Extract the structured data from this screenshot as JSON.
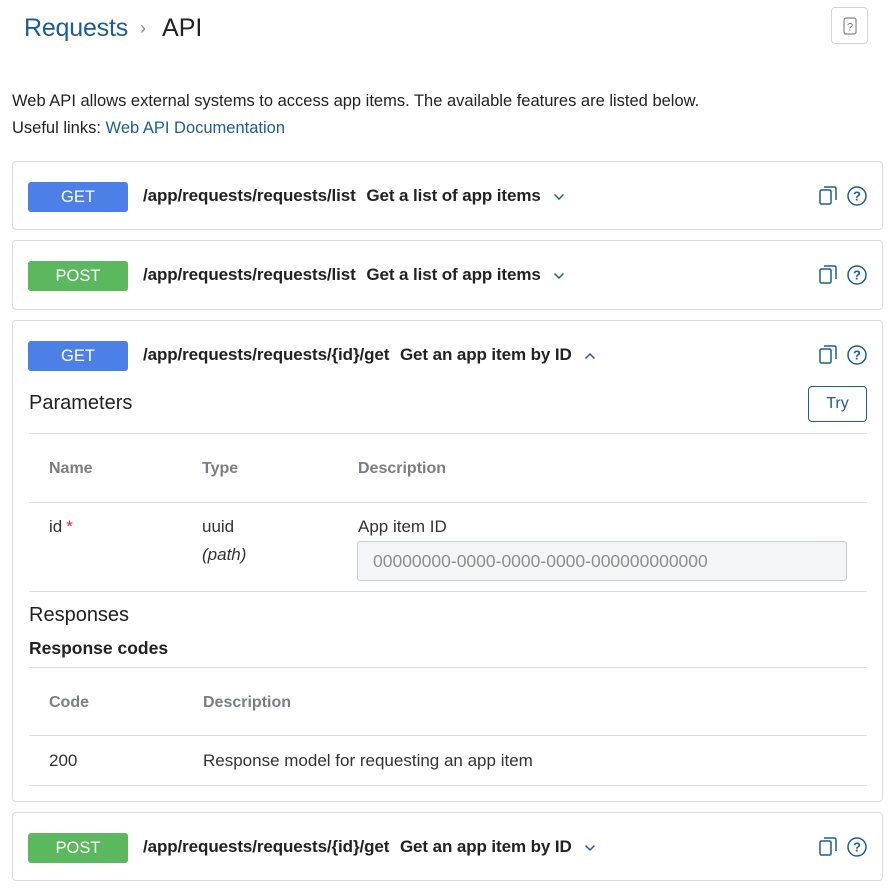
{
  "breadcrumb": {
    "parent": "Requests",
    "separator": "›",
    "current": "API"
  },
  "header": {
    "help_icon": "help-question-icon"
  },
  "intro": {
    "line1": "Web API allows external systems to access app items. The available features are listed below.",
    "links_label": "Useful links:",
    "doc_link": "Web API Documentation"
  },
  "endpoints": [
    {
      "method": "GET",
      "path": "/app/requests/requests/list",
      "description": "Get a list of app items",
      "expanded": false
    },
    {
      "method": "POST",
      "path": "/app/requests/requests/list",
      "description": "Get a list of app items",
      "expanded": false
    },
    {
      "method": "GET",
      "path": "/app/requests/requests/{id}/get",
      "description": "Get an app item by ID",
      "expanded": true
    },
    {
      "method": "POST",
      "path": "/app/requests/requests/{id}/get",
      "description": "Get an app item by ID",
      "expanded": false
    }
  ],
  "details": {
    "parameters_title": "Parameters",
    "try_label": "Try",
    "param_headers": {
      "name": "Name",
      "type": "Type",
      "description": "Description"
    },
    "param": {
      "name": "id",
      "required_mark": "*",
      "type": "uuid",
      "location": "(path)",
      "description": "App item ID",
      "placeholder": "00000000-0000-0000-0000-000000000000"
    },
    "responses_title": "Responses",
    "response_codes_title": "Response codes",
    "response_headers": {
      "code": "Code",
      "description": "Description"
    },
    "response": {
      "code": "200",
      "description": "Response model for requesting an app item"
    }
  },
  "colors": {
    "get": "#4c80e6",
    "post": "#5cb85f",
    "link": "#1e5d8f",
    "required": "#d7263d"
  },
  "icons": {
    "copy": "copy-icon",
    "help": "help-circle-icon",
    "chevron_down": "chevron-down-icon",
    "chevron_up": "chevron-up-icon"
  }
}
